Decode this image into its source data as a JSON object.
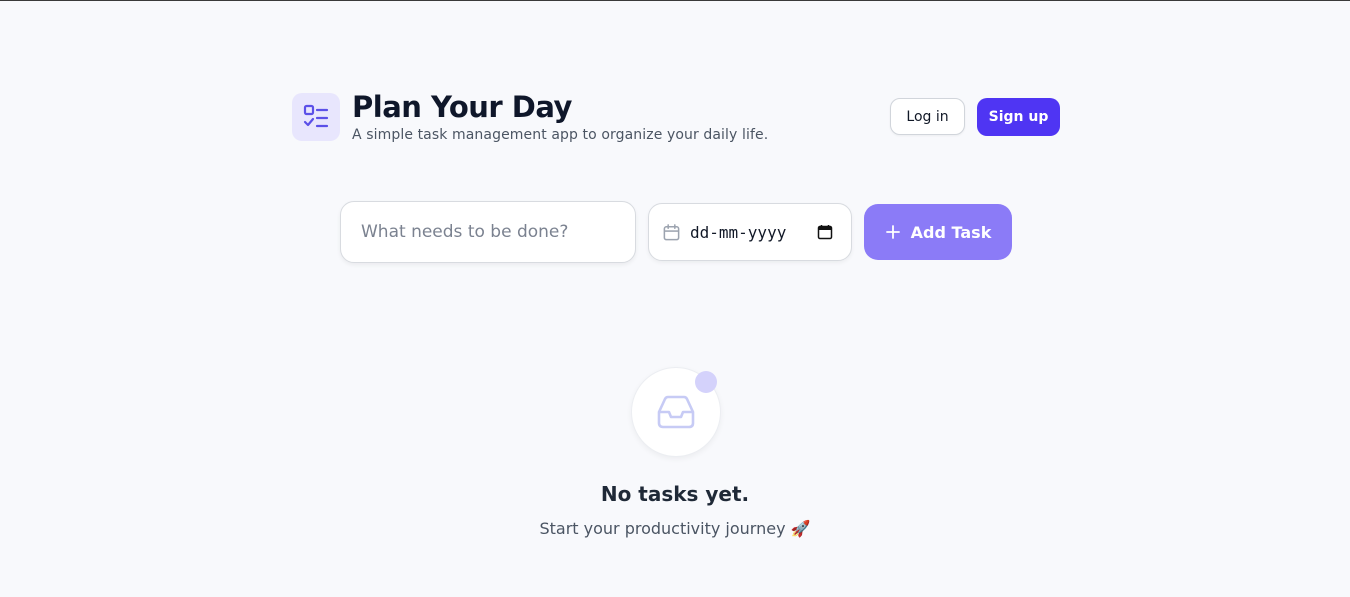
{
  "app": {
    "title": "Plan Your Day",
    "subtitle": "A simple task management app to organize your daily life.",
    "logo_icon": "task-list-icon"
  },
  "auth": {
    "login_label": "Log in",
    "signup_label": "Sign up"
  },
  "task_form": {
    "task_placeholder": "What needs to be done?",
    "task_value": "",
    "date_placeholder": "dd-mm-yyyy",
    "add_label": "Add Task",
    "add_icon": "plus-icon"
  },
  "empty_state": {
    "icon": "inbox-icon",
    "title": "No tasks yet.",
    "subtitle": "Start your productivity journey 🚀"
  },
  "colors": {
    "background": "#f8f9fc",
    "accent": "#4f35f3",
    "accent_light": "#8b7bf7",
    "logo_bg": "#e8e6fd",
    "dot": "#d4d2fb"
  }
}
